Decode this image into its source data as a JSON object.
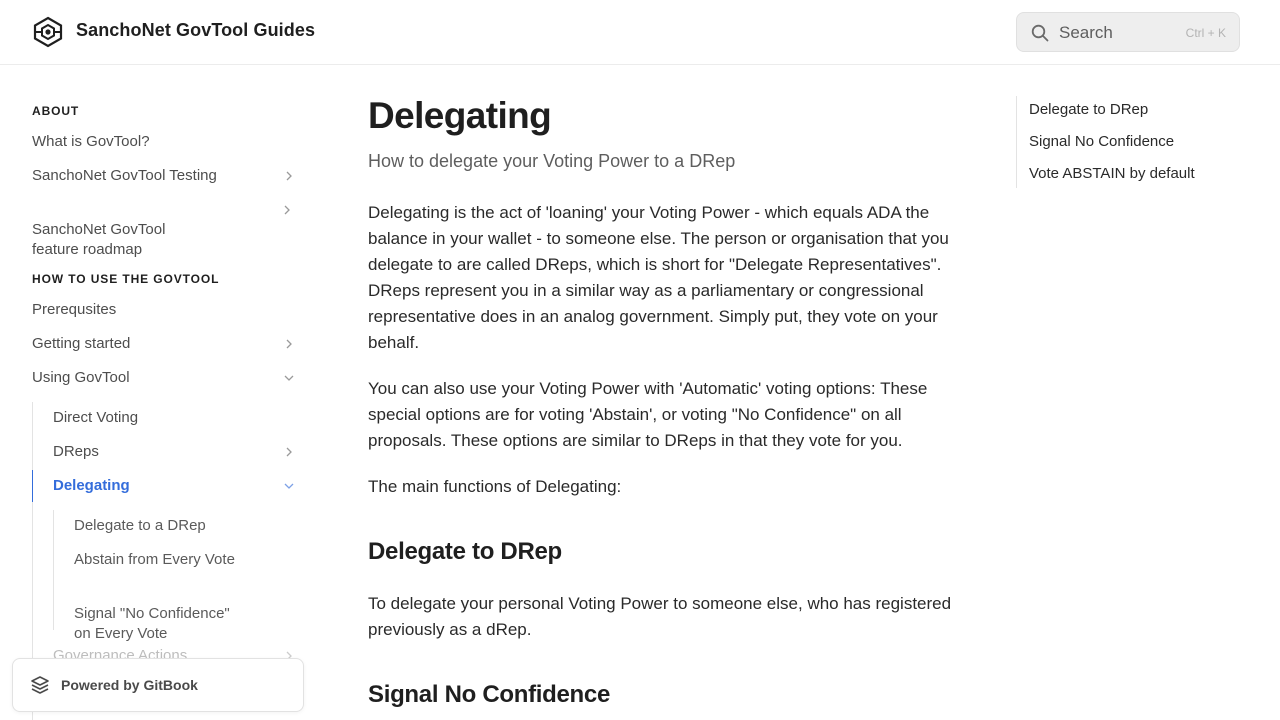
{
  "header": {
    "site_title": "SanchoNet GovTool Guides",
    "search_label": "Search",
    "search_shortcut": "Ctrl + K"
  },
  "sidebar": {
    "section_about": "ABOUT",
    "about_items": [
      {
        "label": "What is GovTool?",
        "chevron": "none"
      },
      {
        "label": "SanchoNet GovTool Testing",
        "chevron": "right"
      },
      {
        "label": "SanchoNet GovTool\nfeature roadmap",
        "chevron": "right"
      }
    ],
    "section_how_to": "HOW TO USE THE GOVTOOL",
    "how_to_items": [
      {
        "label": "Prerequsites",
        "chevron": "none"
      },
      {
        "label": "Getting started",
        "chevron": "right"
      },
      {
        "label": "Using GovTool",
        "chevron": "down"
      }
    ],
    "using_items": [
      {
        "label": "Direct Voting",
        "chevron": "none"
      },
      {
        "label": "DReps",
        "chevron": "right"
      },
      {
        "label": "Delegating",
        "chevron": "down",
        "active": true
      }
    ],
    "delegating_items": [
      {
        "label": "Delegate to a DRep"
      },
      {
        "label": "Abstain from Every Vote"
      },
      {
        "label": "Signal \"No Confidence\"\non Every Vote"
      }
    ],
    "faded_item": "Governance Actions"
  },
  "gitbook": {
    "label": "Powered by GitBook"
  },
  "main": {
    "title": "Delegating",
    "subtitle": "How to delegate your Voting Power to a DRep",
    "paragraph_1": "Delegating is the act of 'loaning' your Voting Power - which equals ADA the balance in your wallet - to someone else. The person or organisation that you delegate to are called DReps, which is short for \"Delegate Representatives\". DReps represent you in a similar way as a parliamentary or congressional representative does in an analog government. Simply put, they vote on your behalf.",
    "paragraph_2": "You can also use your Voting Power with 'Automatic' voting options: These special options are for voting 'Abstain',  or voting \"No Confidence\" on all proposals. These options are similar to DReps in that they vote for you.",
    "paragraph_3": "The main functions of Delegating:",
    "heading_1": "Delegate to DRep",
    "paragraph_4": "To delegate your personal Voting Power to someone else, who has registered previously as a dRep.",
    "heading_2": "Signal No Confidence"
  },
  "toc": {
    "items": [
      "Delegate to DRep",
      "Signal No Confidence",
      "Vote ABSTAIN by default"
    ]
  },
  "colors": {
    "accent": "#346ddb",
    "text": "#1f1f1f",
    "muted": "#5e5e5e"
  },
  "icons": {
    "logo": "sanchonet-hexagon-logo",
    "search": "search-icon",
    "chevron_right": "chevron-right-icon",
    "chevron_down": "chevron-down-icon",
    "gitbook": "gitbook-icon"
  }
}
